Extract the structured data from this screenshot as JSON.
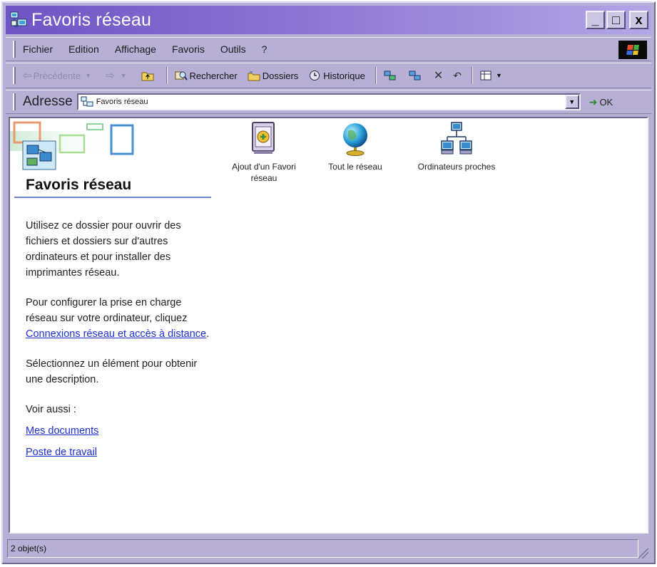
{
  "window": {
    "title": "Favoris réseau",
    "controls": {
      "minimize": "_",
      "maximize": "□",
      "close": "x"
    }
  },
  "menubar": {
    "items": [
      "Fichier",
      "Edition",
      "Affichage",
      "Favoris",
      "Outils",
      "?"
    ]
  },
  "toolbar": {
    "back_label": "Précédente",
    "search_label": "Rechercher",
    "folders_label": "Dossiers",
    "history_label": "Historique",
    "delete_glyph": "✕"
  },
  "address": {
    "label": "Adresse",
    "value": "Favoris réseau",
    "go_label": "OK"
  },
  "left_pane": {
    "title": "Favoris réseau",
    "paragraph1": "Utilisez ce dossier pour ouvrir des fichiers et dossiers sur d'autres ordinateurs et pour installer des imprimantes réseau.",
    "paragraph2_prefix": "Pour configurer la prise en charge réseau sur votre ordinateur, cliquez",
    "paragraph2_link": "Connexions réseau et accès à distance",
    "paragraph2_suffix": ".",
    "paragraph3": "Sélectionnez un élément pour obtenir une description.",
    "see_also": "Voir aussi :",
    "link1": "Mes documents",
    "link2": "Poste de travail"
  },
  "items": [
    {
      "label": "Ajout d'un Favori réseau",
      "icon": "add-network-place-icon"
    },
    {
      "label": "Tout le réseau",
      "icon": "globe-icon"
    },
    {
      "label": "Ordinateurs proches",
      "icon": "network-computers-icon"
    }
  ],
  "status": {
    "text": "2 objet(s)"
  },
  "colors": {
    "titlebar_start": "#6f55c4",
    "chrome": "#b7b0d4",
    "link": "#1a2fd4"
  }
}
